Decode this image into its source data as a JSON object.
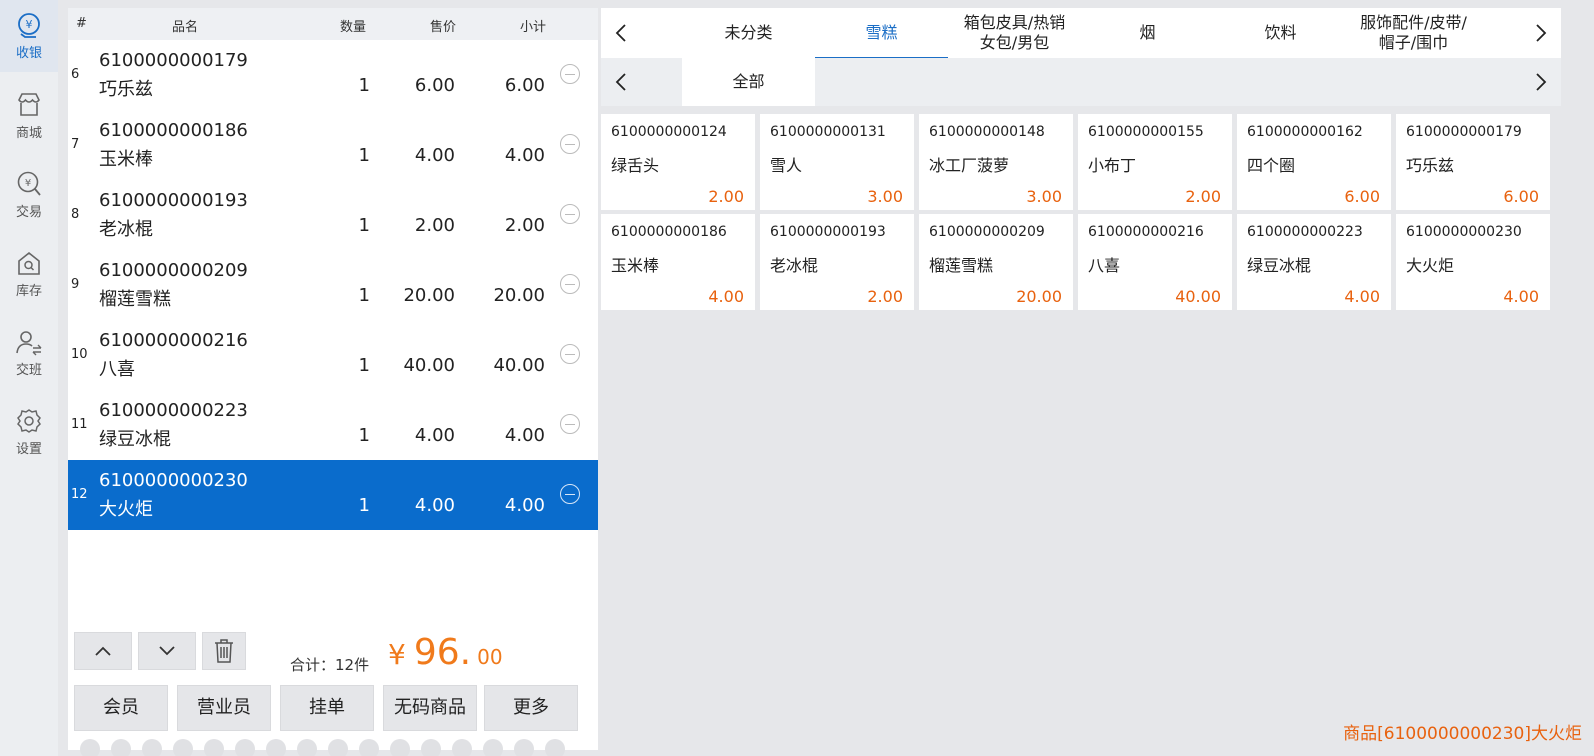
{
  "sidebar": {
    "items": [
      {
        "label": "收银",
        "icon": "cashier-icon",
        "active": true
      },
      {
        "label": "商城",
        "icon": "store-icon",
        "active": false
      },
      {
        "label": "交易",
        "icon": "transaction-icon",
        "active": false
      },
      {
        "label": "库存",
        "icon": "inventory-icon",
        "active": false
      },
      {
        "label": "交班",
        "icon": "shift-handover-icon",
        "active": false
      },
      {
        "label": "设置",
        "icon": "gear-icon",
        "active": false
      }
    ]
  },
  "order": {
    "columns": [
      "#",
      "品名",
      "数量",
      "售价",
      "小计"
    ],
    "rows": [
      {
        "idx": "6",
        "code": "6100000000179",
        "name": "巧乐兹",
        "qty": "1",
        "price": "6.00",
        "subtotal": "6.00"
      },
      {
        "idx": "7",
        "code": "6100000000186",
        "name": "玉米棒",
        "qty": "1",
        "price": "4.00",
        "subtotal": "4.00"
      },
      {
        "idx": "8",
        "code": "6100000000193",
        "name": "老冰棍",
        "qty": "1",
        "price": "2.00",
        "subtotal": "2.00"
      },
      {
        "idx": "9",
        "code": "6100000000209",
        "name": "榴莲雪糕",
        "qty": "1",
        "price": "20.00",
        "subtotal": "20.00"
      },
      {
        "idx": "10",
        "code": "6100000000216",
        "name": "八喜",
        "qty": "1",
        "price": "40.00",
        "subtotal": "40.00"
      },
      {
        "idx": "11",
        "code": "6100000000223",
        "name": "绿豆冰棍",
        "qty": "1",
        "price": "4.00",
        "subtotal": "4.00"
      },
      {
        "idx": "12",
        "code": "6100000000230",
        "name": "大火炬",
        "qty": "1",
        "price": "4.00",
        "subtotal": "4.00",
        "selected": true
      }
    ],
    "total_label": "合计：12件",
    "total_currency": "¥",
    "total_int": "96.",
    "total_dec": "00",
    "actions": [
      "会员",
      "营业员",
      "挂单",
      "无码商品",
      "更多"
    ]
  },
  "catalog": {
    "categories": [
      "未分类",
      "雪糕",
      "箱包皮具/热销\n女包/男包",
      "烟",
      "饮料",
      "服饰配件/皮带/\n帽子/围巾"
    ],
    "active_category": "雪糕",
    "subcategories": [
      "全部"
    ],
    "products": [
      {
        "code": "6100000000124",
        "name": "绿舌头",
        "price": "2.00"
      },
      {
        "code": "6100000000131",
        "name": "雪人",
        "price": "3.00"
      },
      {
        "code": "6100000000148",
        "name": "冰工厂菠萝",
        "price": "3.00"
      },
      {
        "code": "6100000000155",
        "name": "小布丁",
        "price": "2.00"
      },
      {
        "code": "6100000000162",
        "name": "四个圈",
        "price": "6.00"
      },
      {
        "code": "6100000000179",
        "name": "巧乐兹",
        "price": "6.00"
      },
      {
        "code": "6100000000186",
        "name": "玉米棒",
        "price": "4.00"
      },
      {
        "code": "6100000000193",
        "name": "老冰棍",
        "price": "2.00"
      },
      {
        "code": "6100000000209",
        "name": "榴莲雪糕",
        "price": "20.00"
      },
      {
        "code": "6100000000216",
        "name": "八喜",
        "price": "40.00"
      },
      {
        "code": "6100000000223",
        "name": "绿豆冰棍",
        "price": "4.00"
      },
      {
        "code": "6100000000230",
        "name": "大火炬",
        "price": "4.00"
      }
    ]
  },
  "status_text": "商品[6100000000230]大火炬",
  "colors": {
    "accent": "#0a6ccc",
    "price": "#e8620f",
    "total": "#f07a1b"
  }
}
